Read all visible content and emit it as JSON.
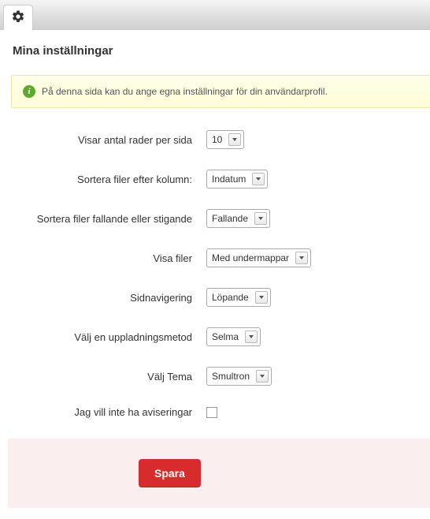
{
  "page_title": "Mina inställningar",
  "info_message": "På denna sida kan du ange egna inställningar för din användarprofil.",
  "fields": {
    "rows_per_page": {
      "label": "Visar antal rader per sida",
      "value": "10"
    },
    "sort_column": {
      "label": "Sortera filer efter kolumn:",
      "value": "Indatum"
    },
    "sort_direction": {
      "label": "Sortera filer fallande eller stigande",
      "value": "Fallande"
    },
    "show_files": {
      "label": "Visa filer",
      "value": "Med undermappar"
    },
    "pagination": {
      "label": "Sidnavigering",
      "value": "Löpande"
    },
    "upload_method": {
      "label": "Välj en uppladningsmetod",
      "value": "Selma"
    },
    "theme": {
      "label": "Välj Tema",
      "value": "Smultron"
    },
    "no_notifications": {
      "label": "Jag vill inte ha aviseringar",
      "checked": false
    }
  },
  "buttons": {
    "save": "Spara"
  }
}
